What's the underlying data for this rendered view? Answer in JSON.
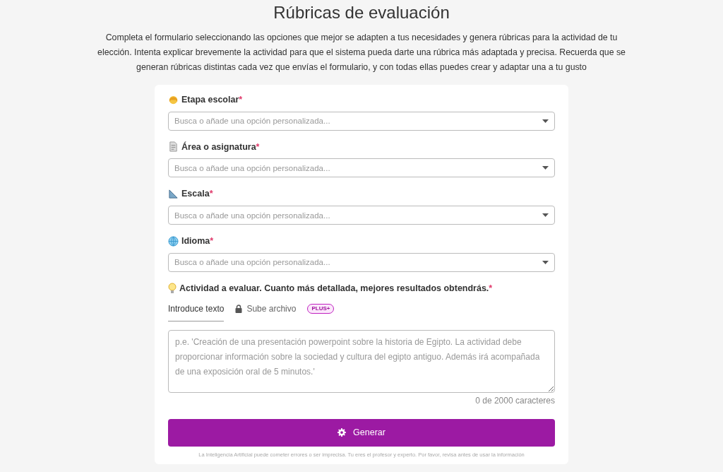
{
  "title": "Rúbricas de evaluación",
  "description": "Completa el formulario seleccionando las opciones que mejor se adapten a tus necesidades y genera rúbricas para la actividad de tu elección. Intenta explicar brevemente la actividad para que el sistema pueda darte una rúbrica más adaptada y precisa. Recuerda que se generan rúbricas distintas cada vez que envías el formulario, y con todas ellas puedes crear y adaptar una a tu gusto",
  "fields": [
    {
      "label": "Etapa escolar",
      "required_mark": "*",
      "placeholder": "Busca o añade una opción personalizada..."
    },
    {
      "label": "Área o asignatura",
      "required_mark": "*",
      "placeholder": "Busca o añade una opción personalizada..."
    },
    {
      "label": "Escala",
      "required_mark": "*",
      "placeholder": "Busca o añade una opción personalizada..."
    },
    {
      "label": "Idioma",
      "required_mark": "*",
      "placeholder": "Busca o añade una opción personalizada..."
    }
  ],
  "activity": {
    "label": "Actividad a evaluar. Cuanto más detallada, mejores resultados obtendrás.",
    "required_mark": "*",
    "tabs": [
      {
        "label": "Introduce texto",
        "selected": true,
        "locked": false
      },
      {
        "label": "Sube archivo",
        "selected": false,
        "locked": true,
        "badge": "PLUS+"
      }
    ],
    "placeholder": "p.e. 'Creación de una presentación powerpoint sobre la historia de Egipto. La actividad debe proporcionar información sobre la sociedad y cultura del egipto antiguo. Además irá acompañada de una exposición oral de 5 minutos.'",
    "counter": "0 de 2000 caracteres"
  },
  "submit": "Generar",
  "disclaimer": "La Inteligencia Artificial puede cometer errores o ser imprecisa. Tu eres el profesor y experto. Por favor, revisa antes de usar la información"
}
